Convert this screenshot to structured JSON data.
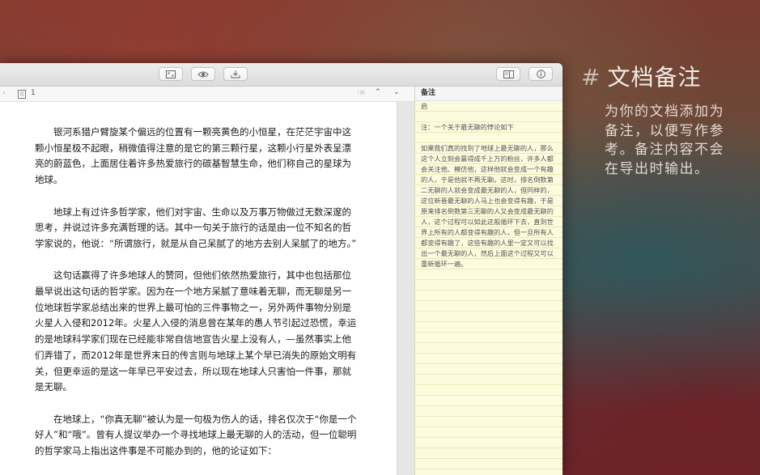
{
  "toolbar": {
    "buttons": [
      {
        "name": "fullscreen-icon"
      },
      {
        "name": "preview-eye-icon"
      },
      {
        "name": "export-download-icon"
      },
      {
        "name": "sidebar-toggle-icon"
      },
      {
        "name": "info-icon"
      }
    ]
  },
  "nav": {
    "back_glyph": "›",
    "page": "1",
    "list_glyph": "⁝≡",
    "up_glyph": "⌃",
    "down_glyph": "⌄"
  },
  "editor": {
    "paragraphs": [
      "银河系猎户臂旋某个偏远的位置有一颗亮黄色的小恒星，在茫茫宇宙中这颗小恒星极不起眼，稍微值得注意的是它的第三颗行星，这颗小行星外表呈漂亮的蔚蓝色，上面居住着许多热爱旅行的碳基智慧生命，他们称自己的星球为地球。",
      "地球上有过许多哲学家，他们对宇宙、生命以及万事万物做过无数深邃的思考，并说过许多充满哲理的话。其中一句关于旅行的话是由一位不知名的哲学家说的，他说：“所谓旅行，就是从自己呆腻了的地方去别人呆腻了的地方。”",
      "这句话赢得了许多地球人的赞同，但他们依然热爱旅行，其中也包括那位最早说出这句话的哲学家。因为在一个地方呆腻了意味着无聊，而无聊是另一位地球哲学家总结出来的世界上最可怕的三件事物之一，另外两件事物分别是火星人入侵和2012年。火星人入侵的消息曾在某年的愚人节引起过恐慌，幸运的是地球科学家们现在已经能非常自信地宣告火星上没有人，—虽然事实上他们弄错了，而2012年是世界末日的传言则与地球上某个早已消失的原始文明有关，但更幸运的是这一年早已平安过去，所以现在地球人只害怕一件事，那就是无聊。",
      "在地球上，“你真无聊”被认为是一句极为伤人的话，排名仅次于“你是一个好人”和“哦”。曾有人提议举办一个寻找地球上最无聊的人的活动，但一位聪明的哲学家马上指出这件事是不可能办到的，他的论证如下："
    ]
  },
  "notes": {
    "header": "备注",
    "lines": [
      "启",
      "",
      "注：一个关于最无聊的悖论如下",
      "",
      "如果我们真的找到了地球上最无聊的人，那么这个人立刻会赢得成千上万的粉丝，许多人都会关注他、模仿他，这样他就会变成一个有趣的人，于是他就不再无聊。这时，排名倒数第二无聊的人就会变成最无聊的人，但同样的，这位新晋最无聊的人马上也会变得有趣，于是原来排名倒数第三无聊的人又会变成最无聊的人，这个过程可以如此这般循环下去，直到世界上所有的人都变得有趣的人，但一旦所有人都变得有趣了，这些有趣的人里一定又可以找出一个最无聊的人，然后上面这个过程又可以重新循环一遍。"
    ]
  },
  "promo": {
    "hash": "#",
    "title": "文档备注",
    "description": "为你的文档添加为备注，以便写作参考。备注内容不会在导出时输出。"
  }
}
